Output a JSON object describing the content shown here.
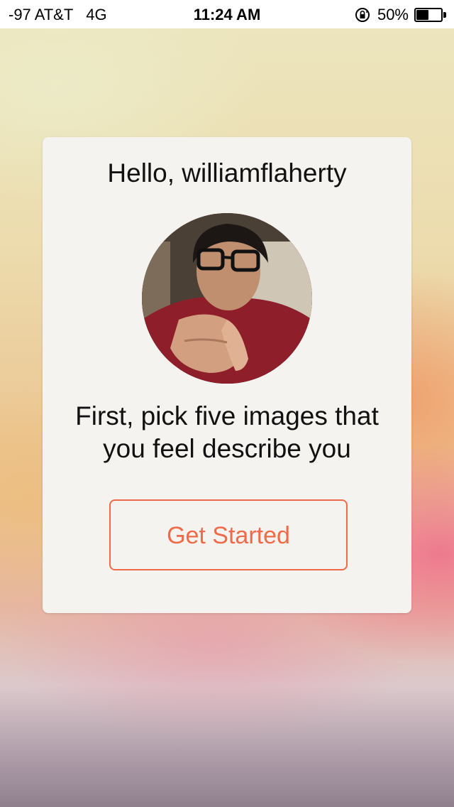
{
  "status_bar": {
    "carrier": "-97 AT&T   4G",
    "time": "11:24 AM",
    "battery_text": "50%",
    "battery_level": 0.5
  },
  "card": {
    "greeting": "Hello, williamflaherty",
    "prompt_line1": "First, pick five images that",
    "prompt_line2": "you feel describe you",
    "button_label": "Get Started"
  },
  "colors": {
    "accent": "#ef6a48",
    "card_background": "#f5f3ef"
  },
  "icons": {
    "rotation_lock": "rotation-lock-icon",
    "battery": "battery-icon"
  }
}
